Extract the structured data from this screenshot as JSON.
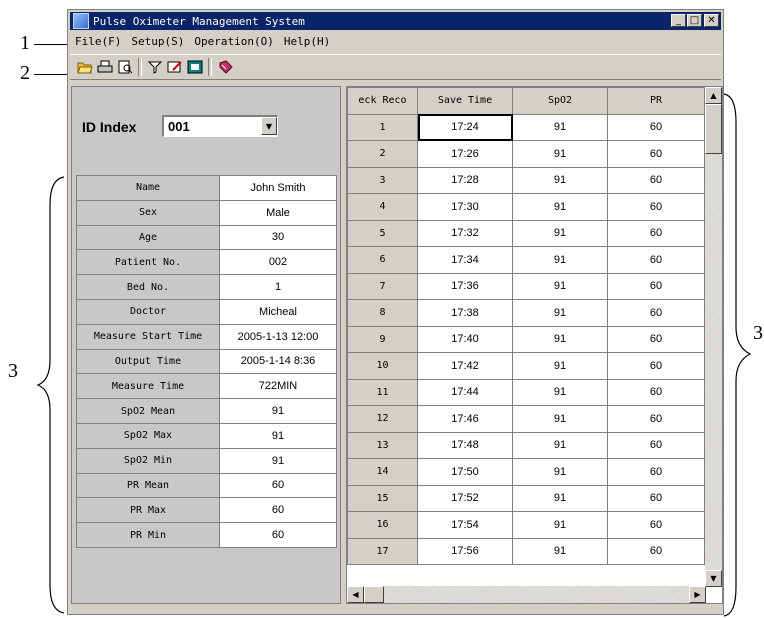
{
  "callouts": {
    "c1": "1",
    "c2": "2",
    "c3_left": "3",
    "c3_right": "3"
  },
  "window": {
    "title": "Pulse Oximeter Management System",
    "title_bar_color": "#0a246a"
  },
  "window_buttons": {
    "minimize": "_",
    "maximize": "□",
    "close": "✕"
  },
  "menu": [
    "File(F)",
    "Setup(S)",
    "Operation(O)",
    "Help(H)"
  ],
  "toolbar_icons": [
    "open-icon",
    "print-icon",
    "print-preview-icon",
    "filter-icon",
    "edit-icon",
    "record-icon",
    "book-icon"
  ],
  "id_index": {
    "label": "ID Index",
    "value": "001"
  },
  "patient_info": [
    {
      "key": "Name",
      "value": "John Smith"
    },
    {
      "key": "Sex",
      "value": "Male"
    },
    {
      "key": "Age",
      "value": "30"
    },
    {
      "key": "Patient No.",
      "value": "002"
    },
    {
      "key": "Bed No.",
      "value": "1"
    },
    {
      "key": "Doctor",
      "value": "Micheal"
    },
    {
      "key": "Measure Start Time",
      "value": "2005-1-13 12:00"
    },
    {
      "key": "Output Time",
      "value": "2005-1-14 8:36"
    },
    {
      "key": "Measure Time",
      "value": "722MIN"
    },
    {
      "key": "SpO2 Mean",
      "value": "91"
    },
    {
      "key": "SpO2 Max",
      "value": "91"
    },
    {
      "key": "SpO2 Min",
      "value": "91"
    },
    {
      "key": "PR Mean",
      "value": "60"
    },
    {
      "key": "PR Max",
      "value": "60"
    },
    {
      "key": "PR Min",
      "value": "60"
    }
  ],
  "grid": {
    "columns": [
      "eck Reco",
      "Save Time",
      "SpO2",
      "PR"
    ],
    "rows": [
      {
        "n": "1",
        "time": "17:24",
        "spo2": "91",
        "pr": "60"
      },
      {
        "n": "2",
        "time": "17:26",
        "spo2": "91",
        "pr": "60"
      },
      {
        "n": "3",
        "time": "17:28",
        "spo2": "91",
        "pr": "60"
      },
      {
        "n": "4",
        "time": "17:30",
        "spo2": "91",
        "pr": "60"
      },
      {
        "n": "5",
        "time": "17:32",
        "spo2": "91",
        "pr": "60"
      },
      {
        "n": "6",
        "time": "17:34",
        "spo2": "91",
        "pr": "60"
      },
      {
        "n": "7",
        "time": "17:36",
        "spo2": "91",
        "pr": "60"
      },
      {
        "n": "8",
        "time": "17:38",
        "spo2": "91",
        "pr": "60"
      },
      {
        "n": "9",
        "time": "17:40",
        "spo2": "91",
        "pr": "60"
      },
      {
        "n": "10",
        "time": "17:42",
        "spo2": "91",
        "pr": "60"
      },
      {
        "n": "11",
        "time": "17:44",
        "spo2": "91",
        "pr": "60"
      },
      {
        "n": "12",
        "time": "17:46",
        "spo2": "91",
        "pr": "60"
      },
      {
        "n": "13",
        "time": "17:48",
        "spo2": "91",
        "pr": "60"
      },
      {
        "n": "14",
        "time": "17:50",
        "spo2": "91",
        "pr": "60"
      },
      {
        "n": "15",
        "time": "17:52",
        "spo2": "91",
        "pr": "60"
      },
      {
        "n": "16",
        "time": "17:54",
        "spo2": "91",
        "pr": "60"
      },
      {
        "n": "17",
        "time": "17:56",
        "spo2": "91",
        "pr": "60"
      }
    ]
  },
  "scroll_glyphs": {
    "up": "▲",
    "down": "▼",
    "left": "◀",
    "right": "▶"
  }
}
